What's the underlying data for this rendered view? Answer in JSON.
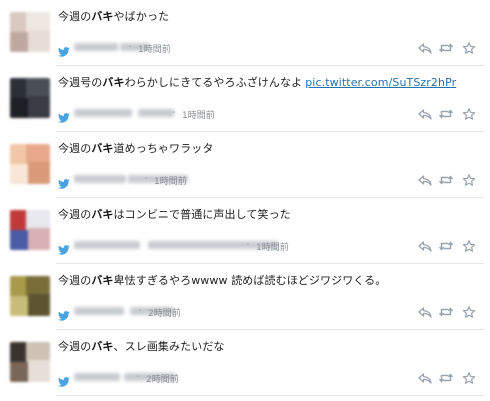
{
  "tweets": [
    {
      "parts": [
        {
          "t": "今週の",
          "b": false
        },
        {
          "t": "バキ",
          "b": true
        },
        {
          "t": "やばかった",
          "b": false
        }
      ],
      "link": "",
      "time": "1時間前",
      "avatar": [
        "#d8c8c0",
        "#efe8e2",
        "#bfa8a0",
        "#e7dcd6"
      ]
    },
    {
      "parts": [
        {
          "t": "今週号の",
          "b": false
        },
        {
          "t": "バキ",
          "b": true
        },
        {
          "t": "わらかしにきてるやろふざけんなよ",
          "b": false
        }
      ],
      "link": "pic.twitter.com/SuTSzr2hPr",
      "time": "1時間前",
      "avatar": [
        "#2b2f36",
        "#4a4f57",
        "#1c1f24",
        "#3a3d44"
      ]
    },
    {
      "parts": [
        {
          "t": "今週の",
          "b": false
        },
        {
          "t": "バキ",
          "b": true
        },
        {
          "t": "道めっちゃワラッタ",
          "b": false
        }
      ],
      "link": "",
      "time": "1時間前",
      "avatar": [
        "#f2c7a7",
        "#e8a88a",
        "#f9e6d6",
        "#d89a78"
      ]
    },
    {
      "parts": [
        {
          "t": "今週の",
          "b": false
        },
        {
          "t": "バキ",
          "b": true
        },
        {
          "t": "はコンビニで普通に声出して笑った",
          "b": false
        }
      ],
      "link": "",
      "time": "1時間前",
      "avatar": [
        "#c13a3a",
        "#e7e7ee",
        "#4a5ba8",
        "#d9b0b4"
      ]
    },
    {
      "parts": [
        {
          "t": "今週の",
          "b": false
        },
        {
          "t": "バキ",
          "b": true
        },
        {
          "t": "卑怯すぎるやろwwww 読めば読むほどジワジワくる。",
          "b": false
        }
      ],
      "link": "",
      "time": "2時間前",
      "avatar": [
        "#a89a4a",
        "#7a6e38",
        "#c9bd7a",
        "#5e5430"
      ]
    },
    {
      "parts": [
        {
          "t": "今週の",
          "b": false
        },
        {
          "t": "バキ",
          "b": true
        },
        {
          "t": "、スレ画集みたいだな",
          "b": false
        }
      ],
      "link": "",
      "time": "2時間前",
      "avatar": [
        "#3a332c",
        "#cfc2b5",
        "#7a6658",
        "#e7dfd7"
      ]
    }
  ],
  "icons": {
    "reply": "reply-icon",
    "retweet": "retweet-icon",
    "favorite": "star-icon",
    "bird": "twitter-bird-icon"
  },
  "colors": {
    "link": "#2a6fb0",
    "bird": "#4aa3df",
    "action": "#9aa3ad",
    "separator": "#e6e6e6"
  }
}
